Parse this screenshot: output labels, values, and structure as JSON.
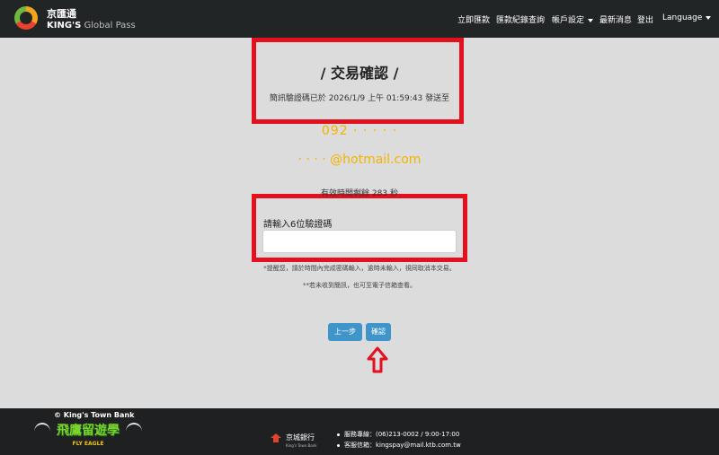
{
  "navbar": {
    "brand_cn": "京匯通",
    "brand_en_bold": "KING'S",
    "brand_en_thin": "Global Pass",
    "items": [
      "立即匯款",
      "匯款紀錄查詢",
      "帳戶設定",
      "最新消息",
      "登出",
      "Language"
    ]
  },
  "main": {
    "title": "/ 交易確認 /",
    "sent_line": "簡訊驗證碼已於 2026/1/9 上午 01:59:43 發送至",
    "phone": "092  ·  ·  · ·  ·",
    "email": "·  ·  ·  ·  @hotmail.com",
    "countdown": "有效時間剩餘 283 秒",
    "otp_label": "請輸入6位驗證碼",
    "otp_value": "",
    "note1": "*提醒您，請於時間內完成密碼輸入，逾時未輸入，視同取消本交易。",
    "note2": "**若未收到簡訊，也可至電子信箱查看。",
    "prev_button": "上一步",
    "confirm_button": "確認"
  },
  "footer": {
    "copyright": "© King's Town Bank",
    "badge_main": "飛鷹留遊學",
    "badge_sub": "FLY EAGLE",
    "bank_cn": "京城銀行",
    "bank_en": "King's Town Bank",
    "service_line": "服務專線：(06)213-0002 / 9:00-17:00",
    "email_line": "客服信箱：kingspay@mail.ktb.com.tw"
  },
  "colors": {
    "highlight": "#e3101e",
    "button": "#3f95c9",
    "masked_text": "#f3b400"
  }
}
